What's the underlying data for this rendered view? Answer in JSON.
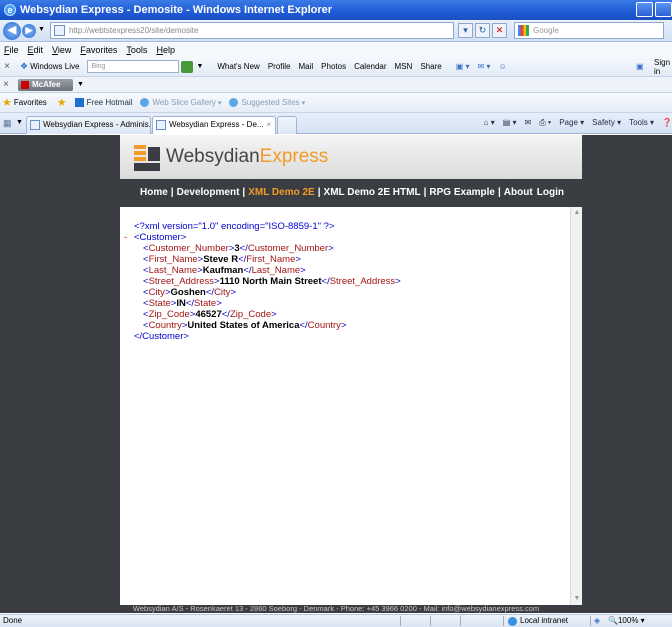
{
  "window": {
    "title": "Websydian Express - Demosite - Windows Internet Explorer"
  },
  "address_bar": {
    "url": "http://webtstexpress20/site/demosite",
    "search_placeholder": "Google"
  },
  "menu": [
    "File",
    "Edit",
    "View",
    "Favorites",
    "Tools",
    "Help"
  ],
  "live_toolbar": {
    "brand": "Windows Live",
    "search_placeholder": "Bing",
    "links": [
      "What's New",
      "Profile",
      "Mail",
      "Photos",
      "Calendar",
      "MSN",
      "Share"
    ],
    "sign_in": "Sign in"
  },
  "mcafee": {
    "label": "McAfee"
  },
  "favorites_bar": {
    "label": "Favorites",
    "items": [
      "Free Hotmail",
      "Web Slice Gallery",
      "Suggested Sites"
    ]
  },
  "tabs": [
    {
      "label": "Websydian Express - Adminis..."
    },
    {
      "label": "Websydian Express - De..."
    }
  ],
  "command_bar": {
    "page": "Page",
    "safety": "Safety",
    "tools": "Tools"
  },
  "site": {
    "logo_left": "Websydian",
    "logo_right": "Express",
    "nav": [
      {
        "label": "Home"
      },
      {
        "label": "Development"
      },
      {
        "label": "XML Demo 2E",
        "current": true
      },
      {
        "label": "XML Demo 2E HTML"
      },
      {
        "label": "RPG Example"
      },
      {
        "label": "About"
      }
    ],
    "login": "Login",
    "xml": {
      "declaration": "<?xml version=\"1.0\" encoding=\"ISO-8859-1\" ?>",
      "minus": "-",
      "root_open": "<Customer>",
      "root_close": "</Customer>",
      "fields": [
        {
          "tag": "Customer_Number",
          "value": "3"
        },
        {
          "tag": "First_Name",
          "value": "Steve R"
        },
        {
          "tag": "Last_Name",
          "value": "Kaufman"
        },
        {
          "tag": "Street_Address",
          "value": "1110 North Main Street"
        },
        {
          "tag": "City",
          "value": "Goshen"
        },
        {
          "tag": "State",
          "value": "IN"
        },
        {
          "tag": "Zip_Code",
          "value": "46527"
        },
        {
          "tag": "Country",
          "value": "United States of America"
        }
      ]
    },
    "footer": "Websydian A/S - Rosenkaeret 13 - 2860 Soeborg - Denmark - Phone: +45 3966 0200 - Mail: info@websydianexpress.com"
  },
  "status_bar": {
    "status": "Done",
    "zone": "Local intranet",
    "zoom": "100%"
  },
  "colors": {
    "accent_orange": "#f29b28",
    "site_dark": "#3a3e42",
    "xml_tag": "#a31515",
    "xml_bracket": "#0000cc"
  }
}
